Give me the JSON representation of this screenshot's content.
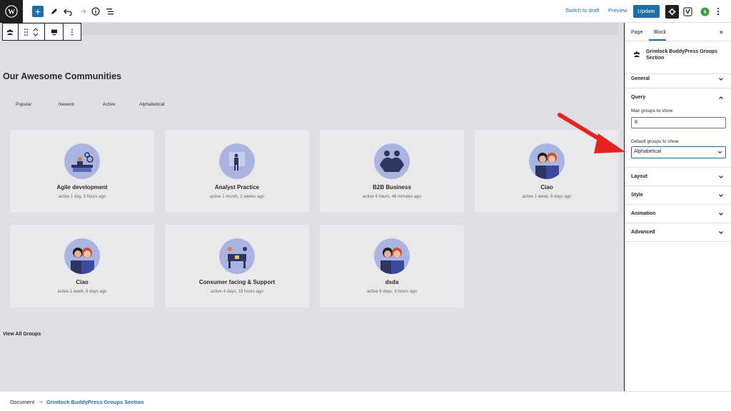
{
  "topbar": {
    "switch_to_draft": "Switch to draft",
    "preview": "Preview",
    "update": "Update",
    "add_label": "+"
  },
  "canvas": {
    "heading": "Our Awesome Communities",
    "tabs": [
      "Popular",
      "Newest",
      "Active",
      "Alphabetical"
    ],
    "groups": [
      {
        "title": "Agile development",
        "meta": "active 1 day, 3 hours ago",
        "icon": "team-desk-illustration"
      },
      {
        "title": "Analyst Practice",
        "meta": "active 1 month, 2 weeks ago",
        "icon": "presenter-illustration"
      },
      {
        "title": "B2B Business",
        "meta": "active 4 hours, 46 minutes ago",
        "icon": "handshake-illustration"
      },
      {
        "title": "Ciao",
        "meta": "active 1 week, 6 days ago",
        "icon": "people-avatar-illustration"
      },
      {
        "title": "Ciao",
        "meta": "active 1 week, 6 days ago",
        "icon": "people-avatar-illustration"
      },
      {
        "title": "Consumer facing & Support",
        "meta": "active 4 days, 18 hours ago",
        "icon": "support-illustration"
      },
      {
        "title": "dsda",
        "meta": "active 6 days, 4 hours ago",
        "icon": "people-avatar-illustration"
      }
    ],
    "view_all": "View All Groups"
  },
  "statusbar": {
    "document": "Document",
    "arrow": "→",
    "block": "Grimlock BuddyPress Groups Section"
  },
  "sidebar": {
    "tab_page": "Page",
    "tab_block": "Block",
    "close": "✕",
    "block_name": "Grimlock BuddyPress Groups Section",
    "panels": {
      "general": "General",
      "query": "Query",
      "layout": "Layout",
      "style": "Style",
      "animation": "Animation",
      "advanced": "Advanced"
    },
    "max_groups_label": "Max groups to show",
    "max_groups_value": "8",
    "default_groups_label": "Default groups to show",
    "default_groups_value": "Alphabetical"
  },
  "colors": {
    "accent": "#1e6fa8",
    "annotation_arrow": "#e8231f",
    "illustration_bg": "#a9b4e0",
    "illustration_dark": "#2f3562"
  }
}
